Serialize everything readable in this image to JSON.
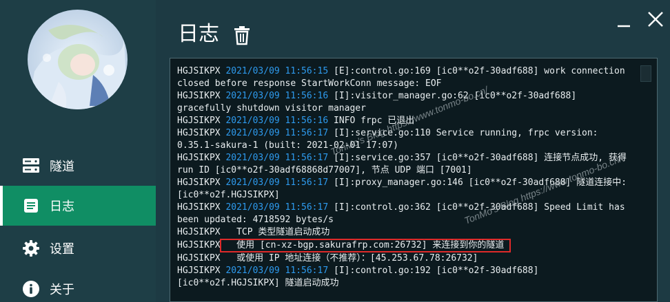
{
  "sidebar": {
    "items": [
      {
        "label": "隧道",
        "icon": "server-icon",
        "active": false
      },
      {
        "label": "日志",
        "icon": "document-icon",
        "active": true
      },
      {
        "label": "设置",
        "icon": "gear-icon",
        "active": false
      },
      {
        "label": "关于",
        "icon": "info-icon",
        "active": false
      }
    ]
  },
  "header": {
    "title": "日志"
  },
  "colors": {
    "sidebar_bg": "#1e3e46",
    "active_nav": "#108e64",
    "log_bg": "#0c1a1f",
    "timestamp": "#2e9bef",
    "highlight_box": "#e02a2a"
  },
  "log": [
    {
      "tag": "HGJSIKPX",
      "dt": "2021/03/09 11:56:15",
      "msg": "[E]:control.go:169 [ic0**o2f-30adf688] work connection closed before response StartWorkConn message: EOF"
    },
    {
      "tag": "HGJSIKPX",
      "dt": "2021/03/09 11:56:16",
      "msg": "[I]:visitor_manager.go:62 [ic0**o2f-30adf688] gracefully shutdown visitor manager"
    },
    {
      "tag": "HGJSIKPX",
      "dt": "2021/03/09 11:56:16",
      "msg": "INFO frpc 已退出"
    },
    {
      "tag": "HGJSIKPX",
      "dt": "2021/03/09 11:56:17",
      "msg": "[I]:service.go:110 Service running, frpc version: 0.35.1-sakura-1 (built: 2021-02-01 17:07)"
    },
    {
      "tag": "HGJSIKPX",
      "dt": "2021/03/09 11:56:17",
      "msg": "[I]:service.go:357 [ic0**o2f-30adf688] 连接节点成功, 获得 run ID [ic0**o2f-30adf68868d77007], 节点 UDP 端口 [7001]"
    },
    {
      "tag": "HGJSIKPX",
      "dt": "2021/03/09 11:56:17",
      "msg": "[I]:proxy_manager.go:146 [ic0**o2f-30adf688] 隧道连接中: [ic0**o2f.HGJSIKPX]"
    },
    {
      "tag": "HGJSIKPX",
      "dt": "2021/03/09 11:56:17",
      "msg": "[I]:control.go:362 [ic0**o2f-30adf688] Speed Limit has been updated: 4718592 bytes/s"
    },
    {
      "tag": "HGJSIKPX",
      "dt": "",
      "msg": "  TCP 类型隧道启动成功"
    },
    {
      "tag": "HGJSIKPX",
      "dt": "",
      "msg": "  使用 [cn-xz-bgp.sakurafrp.com:26732] 来连接到你的隧道",
      "highlight": true
    },
    {
      "tag": "HGJSIKPX",
      "dt": "",
      "msg": "  或使用 IP 地址连接（不推荐）：[45.253.67.78:26732]"
    },
    {
      "tag": "HGJSIKPX",
      "dt": "2021/03/09 11:56:17",
      "msg": "[I]:control.go:192 [ic0**o2f-30adf688] [ic0**o2f.HGJSIKPX] 隧道启动成功"
    }
  ],
  "watermark": {
    "line1": "TonMo's Blog https://www.tonmo-bo.cn/",
    "line2": "TonMo's Blog https://www.tonmo-bo.cn/"
  }
}
